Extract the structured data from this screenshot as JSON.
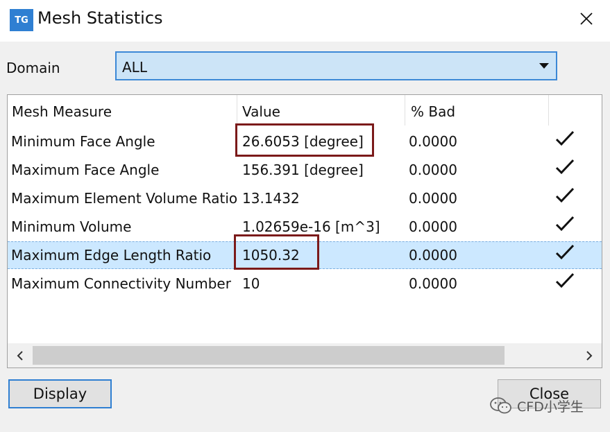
{
  "window": {
    "app_icon_text": "TG",
    "title": "Mesh Statistics"
  },
  "domain": {
    "label": "Domain",
    "selected": "ALL"
  },
  "table": {
    "columns": [
      "Mesh Measure",
      "Value",
      "% Bad"
    ],
    "rows": [
      {
        "measure": "Minimum Face Angle",
        "value": "26.6053 [degree]",
        "bad": "0.0000",
        "ok": true,
        "highlighted_value": true,
        "selected": false
      },
      {
        "measure": "Maximum Face Angle",
        "value": "156.391 [degree]",
        "bad": "0.0000",
        "ok": true,
        "highlighted_value": false,
        "selected": false
      },
      {
        "measure": "Maximum Element Volume Ratio",
        "value": "13.1432",
        "bad": "0.0000",
        "ok": true,
        "highlighted_value": false,
        "selected": false
      },
      {
        "measure": "Minimum Volume",
        "value": "1.02659e-16 [m^3]",
        "bad": "0.0000",
        "ok": true,
        "highlighted_value": false,
        "selected": false
      },
      {
        "measure": "Maximum Edge Length Ratio",
        "value": "1050.32",
        "bad": "0.0000",
        "ok": true,
        "highlighted_value": true,
        "selected": true
      },
      {
        "measure": "Maximum Connectivity Number",
        "value": "10",
        "bad": "0.0000",
        "ok": true,
        "highlighted_value": false,
        "selected": false
      }
    ]
  },
  "buttons": {
    "display": "Display",
    "close": "Close"
  },
  "watermark": {
    "text": "CFD小学生"
  },
  "colors": {
    "accent": "#2f7fd2",
    "selection": "#cce8ff",
    "highlight_box": "#7b1a1a"
  }
}
